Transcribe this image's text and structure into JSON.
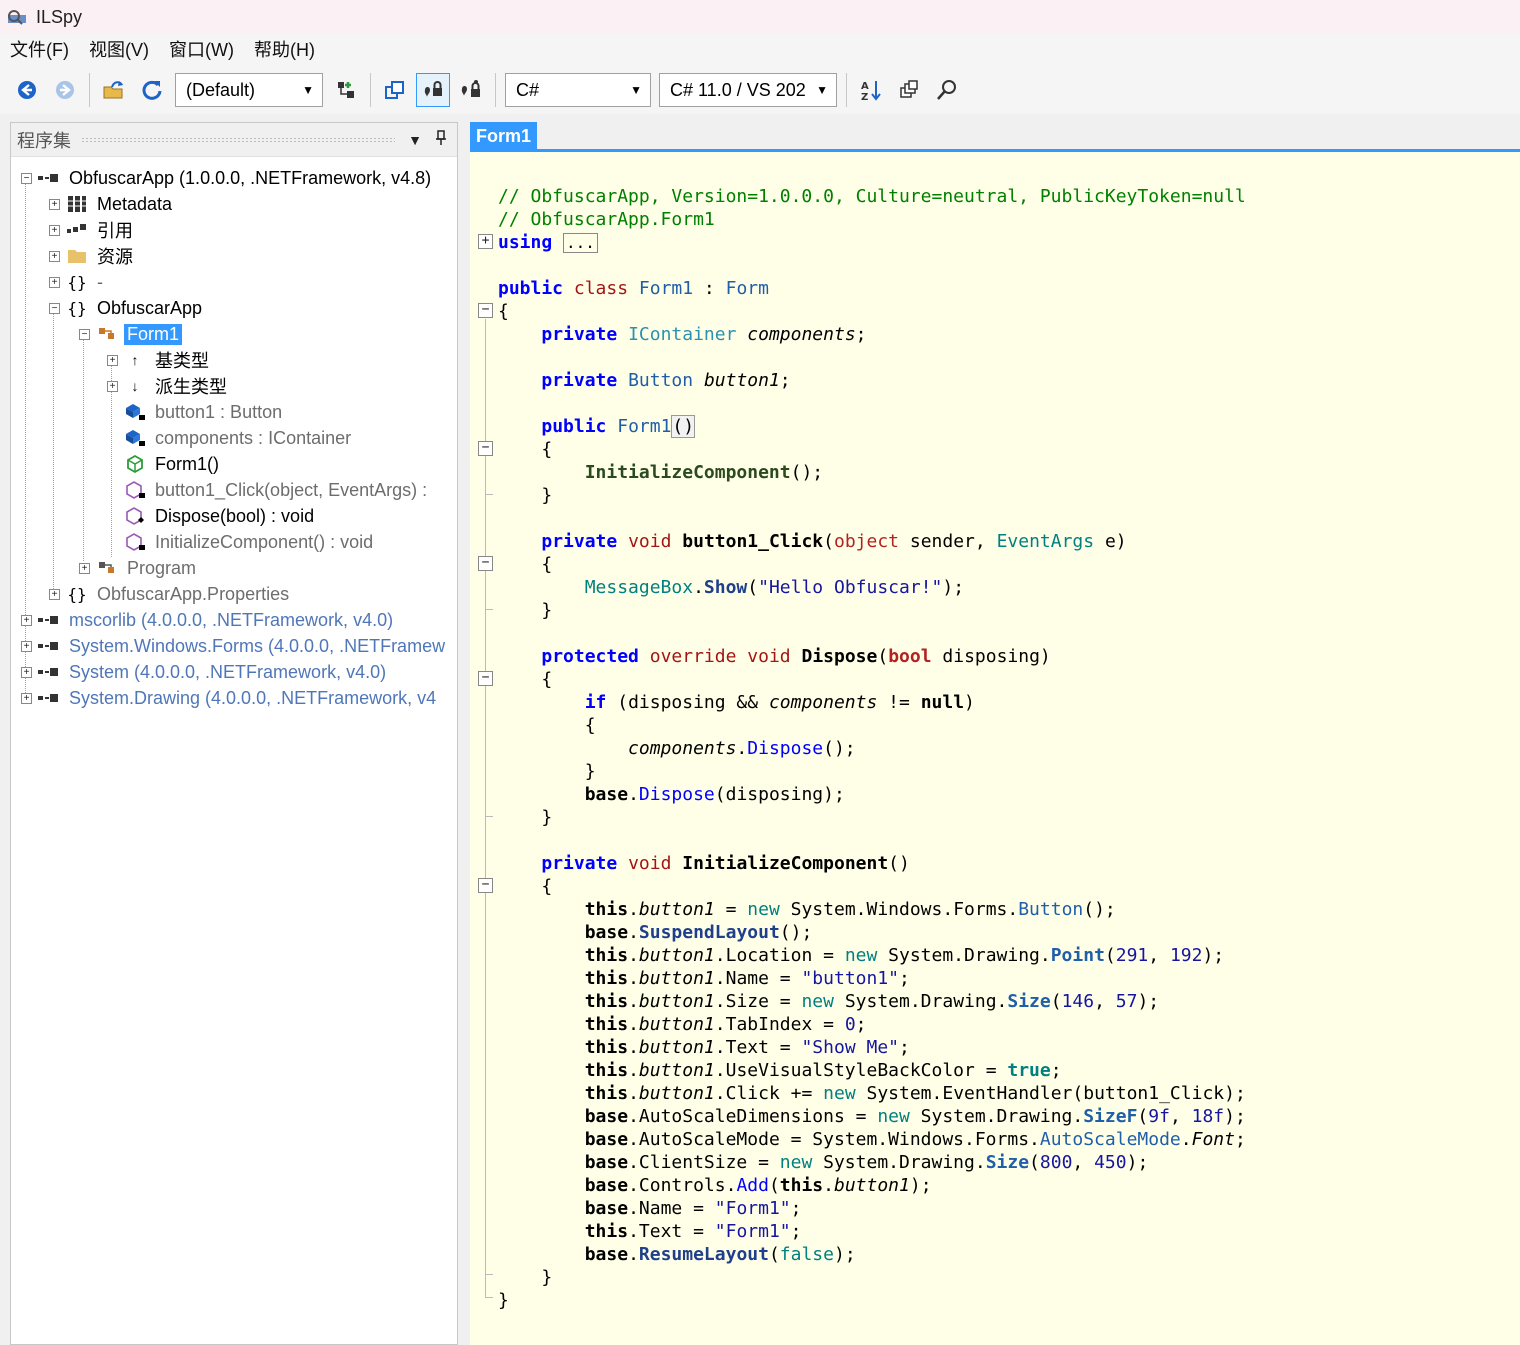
{
  "window": {
    "title": "ILSpy"
  },
  "menu": [
    "文件(F)",
    "视图(V)",
    "窗口(W)",
    "帮助(H)"
  ],
  "toolbar": {
    "profile_combo": "(Default)",
    "language_combo": "C#",
    "version_combo": "C# 11.0 / VS 202"
  },
  "assemblies_panel": {
    "title": "程序集",
    "tree": [
      {
        "label": "ObfuscarApp (1.0.0.0, .NETFramework, v4.8)",
        "icon": "assembly-icon"
      },
      {
        "label": "Metadata",
        "icon": "metadata-icon"
      },
      {
        "label": "引用",
        "icon": "references-icon"
      },
      {
        "label": "资源",
        "icon": "folder-icon"
      },
      {
        "label": "-",
        "icon": "namespace-icon"
      },
      {
        "label": "ObfuscarApp",
        "icon": "namespace-icon"
      },
      {
        "label": "Form1",
        "icon": "class-icon"
      },
      {
        "label": "基类型",
        "icon": "base-types-icon"
      },
      {
        "label": "派生类型",
        "icon": "derived-types-icon"
      },
      {
        "label": "button1 : Button",
        "icon": "private-field-icon"
      },
      {
        "label": "components : IContainer",
        "icon": "private-field-icon"
      },
      {
        "label": "Form1()",
        "icon": "method-icon"
      },
      {
        "label": "button1_Click(object, EventArgs) :",
        "icon": "private-method-icon"
      },
      {
        "label": "Dispose(bool) : void",
        "icon": "protected-method-icon"
      },
      {
        "label": "InitializeComponent() : void",
        "icon": "private-method-icon"
      },
      {
        "label": "Program",
        "icon": "class-icon"
      },
      {
        "label": "ObfuscarApp.Properties",
        "icon": "namespace-icon"
      },
      {
        "label": "mscorlib (4.0.0.0, .NETFramework, v4.0)",
        "icon": "assembly-icon"
      },
      {
        "label": "System.Windows.Forms (4.0.0.0, .NETFramew",
        "icon": "assembly-icon"
      },
      {
        "label": "System (4.0.0.0, .NETFramework, v4.0)",
        "icon": "assembly-icon"
      },
      {
        "label": "System.Drawing (4.0.0.0, .NETFramework, v4",
        "icon": "assembly-icon"
      }
    ]
  },
  "editor": {
    "tab_label": "Form1",
    "colors": {
      "background": "#ffffe8",
      "accent": "#3399ff"
    }
  }
}
